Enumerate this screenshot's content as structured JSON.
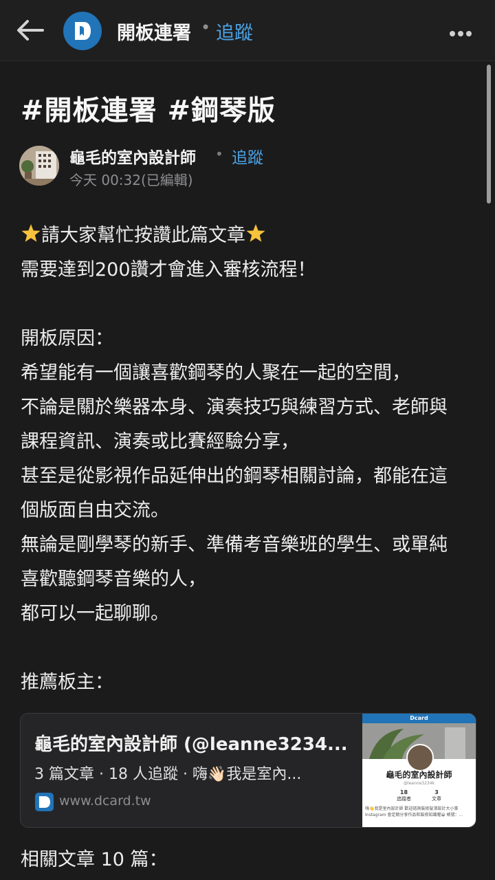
{
  "header": {
    "back_icon": "arrow-left-icon",
    "board_logo_icon": "dcard-logo-icon",
    "board_name": "開板連署",
    "separator": "•",
    "follow_label": "追蹤",
    "more_icon": "more-dots-icon"
  },
  "post": {
    "title": "#開板連署 #鋼琴版",
    "author": {
      "name": "龜毛的室內設計師",
      "separator": "•",
      "follow_label": "追蹤",
      "timestamp": "今天 00:32(已編輯)"
    },
    "lines": {
      "l1": "請大家幫忙按讚此篇文章",
      "l2": "需要達到200讚才會進入審核流程！",
      "l3": "開板原因：",
      "l4": "希望能有一個讓喜歡鋼琴的人聚在一起的空間，",
      "l5": "不論是關於樂器本身、演奏技巧與練習方式、老師與",
      "l6": "課程資訊、演奏或比賽經驗分享，",
      "l7": "甚至是從影視作品延伸出的鋼琴相關討論，都能在這",
      "l8": "個版面自由交流。",
      "l9": "無論是剛學琴的新手、準備考音樂班的學生、或單純",
      "l10": "喜歡聽鋼琴音樂的人，",
      "l11": "都可以一起聊聊。",
      "l12": "推薦板主："
    },
    "link_card": {
      "title": "龜毛的室內設計師 (@leanne3234...",
      "description": "3 篇文章 · 18 人追蹤 · 嗨👋🏻我是室內...",
      "domain": "www.dcard.tw",
      "thumbnail": {
        "brand": "Dcard",
        "name": "龜毛的室內設計師",
        "handle": "@leanne3234k",
        "followers_value": "18",
        "followers_label": "追蹤者",
        "posts_value": "3",
        "posts_label": "文章",
        "bio": "嗨👋我是室內設計師 歡迎諮詢裝修髮漲設計大小事 Instagram 會定期分享作品和裝修知識喔😀 帳號：..."
      }
    },
    "related": "相關文章 10 篇："
  },
  "colors": {
    "background": "#1b1b1c",
    "accent": "#4aa3e6",
    "brand": "#2174b8"
  }
}
